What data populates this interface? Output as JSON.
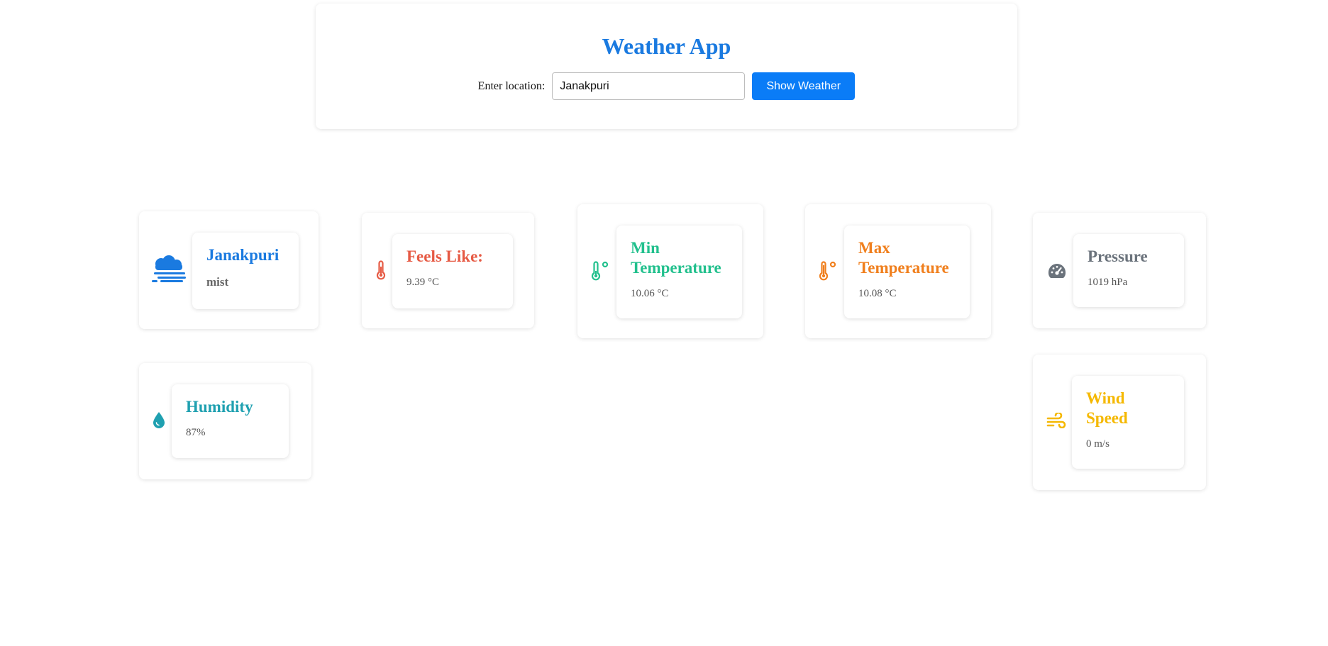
{
  "header": {
    "title": "Weather App",
    "location_label": "Enter location:",
    "location_value": "Janakpuri",
    "show_button": "Show Weather"
  },
  "cards": {
    "location": {
      "title": "Janakpuri",
      "value": "mist",
      "icon": "fog-icon",
      "color": "#1a7ae0"
    },
    "feels_like": {
      "title": "Feels Like:",
      "value": "9.39 °C",
      "icon": "thermometer-icon",
      "color": "#e65a44"
    },
    "min_temp": {
      "title": "Min Temperature",
      "value": "10.06 °C",
      "icon": "thermometer-low-icon",
      "color": "#22c08d"
    },
    "max_temp": {
      "title": "Max Temperature",
      "value": "10.08 °C",
      "icon": "thermometer-high-icon",
      "color": "#f07f1d"
    },
    "pressure": {
      "title": "Pressure",
      "value": "1019 hPa",
      "icon": "gauge-icon",
      "color": "#6b737c"
    },
    "humidity": {
      "title": "Humidity",
      "value": "87%",
      "icon": "droplet-icon",
      "color": "#1fa0b0"
    },
    "wind": {
      "title": "Wind Speed",
      "value": "0 m/s",
      "icon": "wind-icon",
      "color": "#f5b800"
    }
  }
}
